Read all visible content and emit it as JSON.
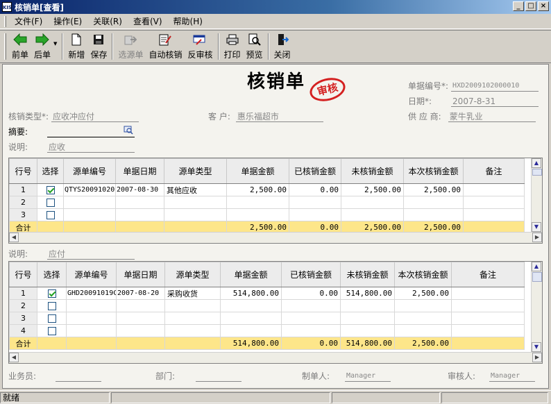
{
  "window": {
    "title": "核销单[查看]",
    "app_icon": "KIS",
    "buttons": {
      "minimize": "_",
      "maximize": "□",
      "close": "×"
    }
  },
  "menu": [
    "文件(F)",
    "操作(E)",
    "关联(R)",
    "查看(V)",
    "帮助(H)"
  ],
  "toolbar": [
    {
      "label": "前单",
      "icon": "arrow-left-icon"
    },
    {
      "label": "后单",
      "icon": "arrow-right-icon",
      "dropdown": true
    },
    {
      "label": "新增",
      "icon": "new-document-icon"
    },
    {
      "label": "保存",
      "icon": "save-icon"
    },
    {
      "label": "选源单",
      "icon": "select-source-icon",
      "disabled": true
    },
    {
      "label": "自动核销",
      "icon": "auto-verify-icon"
    },
    {
      "label": "反审核",
      "icon": "unaudit-icon"
    },
    {
      "label": "打印",
      "icon": "print-icon"
    },
    {
      "label": "预览",
      "icon": "preview-icon"
    },
    {
      "label": "关闭",
      "icon": "close-door-icon"
    }
  ],
  "doc": {
    "title": "核销单",
    "stamp": "审核",
    "number_label": "单据编号*:",
    "number": "HXD2009102000010",
    "date_label": "日期*:",
    "date": "2007-8-31",
    "supplier_label": "供 应 商:",
    "supplier": "蒙牛乳业",
    "type_label": "核销类型*:",
    "type": "应收冲应付",
    "customer_label": "客    户:",
    "customer": "惠乐福超市",
    "summary_label": "摘要:",
    "summary": "",
    "note1_label": "说明:",
    "note1": "应收",
    "note2_label": "说明:",
    "note2": "应付"
  },
  "grid1": {
    "headers": [
      "行号",
      "选择",
      "源单编号",
      "单据日期",
      "源单类型",
      "单据金额",
      "已核销金额",
      "未核销金额",
      "本次核销金额",
      "备注"
    ],
    "rows": [
      {
        "n": "1",
        "checked": true,
        "code": "QTYS20091020",
        "date": "2007-08-30",
        "type": "其他应收",
        "amount": "2,500.00",
        "verified": "0.00",
        "unverified": "2,500.00",
        "current": "2,500.00",
        "memo": ""
      },
      {
        "n": "2",
        "checked": false,
        "code": "",
        "date": "",
        "type": "",
        "amount": "",
        "verified": "",
        "unverified": "",
        "current": "",
        "memo": ""
      },
      {
        "n": "3",
        "checked": false,
        "code": "",
        "date": "",
        "type": "",
        "amount": "",
        "verified": "",
        "unverified": "",
        "current": "",
        "memo": ""
      }
    ],
    "sum": {
      "label": "合计",
      "amount": "2,500.00",
      "verified": "0.00",
      "unverified": "2,500.00",
      "current": "2,500.00"
    }
  },
  "grid2": {
    "headers": [
      "行号",
      "选择",
      "源单编号",
      "单据日期",
      "源单类型",
      "单据金额",
      "已核销金额",
      "未核销金额",
      "本次核销金额",
      "备注"
    ],
    "rows": [
      {
        "n": "1",
        "checked": true,
        "code": "GHD20091019C",
        "date": "2007-08-20",
        "type": "采购收货",
        "amount": "514,800.00",
        "verified": "0.00",
        "unverified": "514,800.00",
        "current": "2,500.00",
        "memo": ""
      },
      {
        "n": "2",
        "checked": false,
        "code": "",
        "date": "",
        "type": "",
        "amount": "",
        "verified": "",
        "unverified": "",
        "current": "",
        "memo": ""
      },
      {
        "n": "3",
        "checked": false,
        "code": "",
        "date": "",
        "type": "",
        "amount": "",
        "verified": "",
        "unverified": "",
        "current": "",
        "memo": ""
      },
      {
        "n": "4",
        "checked": false,
        "code": "",
        "date": "",
        "type": "",
        "amount": "",
        "verified": "",
        "unverified": "",
        "current": "",
        "memo": ""
      }
    ],
    "sum": {
      "label": "合计",
      "amount": "514,800.00",
      "verified": "0.00",
      "unverified": "514,800.00",
      "current": "2,500.00"
    }
  },
  "footer": {
    "salesman_label": "业务员:",
    "salesman": "",
    "dept_label": "部门:",
    "dept": "",
    "maker_label": "制单人:",
    "maker": "Manager",
    "auditor_label": "审核人:",
    "auditor": "Manager"
  },
  "status": {
    "text": "就绪"
  },
  "colors": {
    "title_bar": "#0a246a",
    "sum_row": "#fde68a",
    "stamp": "#d42020",
    "check": "#21a121"
  }
}
